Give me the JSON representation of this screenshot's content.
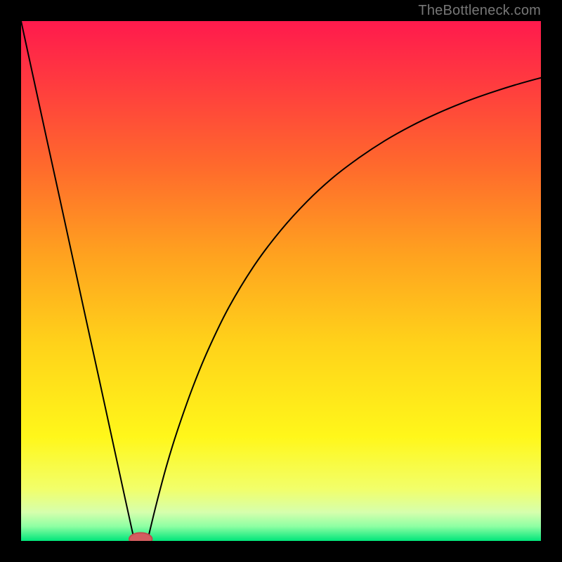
{
  "watermark": "TheBottleneck.com",
  "colors": {
    "black": "#000000",
    "curve": "#000000",
    "marker_fill": "#d35d60",
    "marker_stroke": "#c24a4d"
  },
  "chart_data": {
    "type": "line",
    "title": "",
    "xlabel": "",
    "ylabel": "",
    "xlim": [
      0,
      100
    ],
    "ylim": [
      0,
      100
    ],
    "grid": false,
    "legend": false,
    "background_gradient": {
      "stops": [
        {
          "offset": 0.0,
          "color": "#ff1a4d"
        },
        {
          "offset": 0.12,
          "color": "#ff3b3f"
        },
        {
          "offset": 0.28,
          "color": "#ff6a2c"
        },
        {
          "offset": 0.45,
          "color": "#ffa21f"
        },
        {
          "offset": 0.62,
          "color": "#ffd21a"
        },
        {
          "offset": 0.8,
          "color": "#fff71a"
        },
        {
          "offset": 0.9,
          "color": "#f2ff6a"
        },
        {
          "offset": 0.945,
          "color": "#d6ffad"
        },
        {
          "offset": 0.972,
          "color": "#8effa3"
        },
        {
          "offset": 1.0,
          "color": "#00e57a"
        }
      ]
    },
    "series": [
      {
        "name": "left-branch",
        "x": [
          0.0,
          2.5,
          5.0,
          7.5,
          10.0,
          12.5,
          15.0,
          17.5,
          20.0,
          21.8
        ],
        "y": [
          100.0,
          88.5,
          77.0,
          65.6,
          54.1,
          42.6,
          31.2,
          19.7,
          8.2,
          0.0
        ]
      },
      {
        "name": "right-branch",
        "x": [
          24.3,
          26,
          28,
          30,
          33,
          36,
          40,
          45,
          50,
          55,
          60,
          65,
          70,
          75,
          80,
          85,
          90,
          95,
          100
        ],
        "y": [
          0.0,
          7.0,
          14.5,
          21.0,
          29.5,
          36.8,
          45.0,
          53.2,
          59.8,
          65.3,
          69.9,
          73.7,
          77.0,
          79.8,
          82.2,
          84.3,
          86.1,
          87.7,
          89.1
        ]
      }
    ],
    "marker": {
      "name": "optimal-marker",
      "x": 23.0,
      "y": 0.0,
      "rx": 2.2,
      "ry": 1.2
    }
  }
}
